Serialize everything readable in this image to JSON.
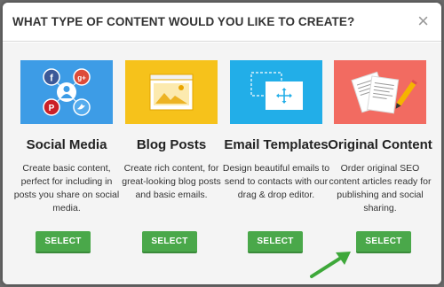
{
  "modal": {
    "title": "WHAT TYPE OF CONTENT WOULD YOU LIKE TO CREATE?",
    "close_glyph": "×"
  },
  "cards": [
    {
      "title": "Social Media",
      "description": "Create basic content, perfect for including in posts you share on social media.",
      "button": "SELECT",
      "image_bg": "#3d9ce6",
      "icon": "social-network-icon"
    },
    {
      "title": "Blog Posts",
      "description": "Create rich content, for great-looking blog posts and basic emails.",
      "button": "SELECT",
      "image_bg": "#f6c21b",
      "icon": "browser-window-icon"
    },
    {
      "title": "Email Templates",
      "description": "Design beautiful emails to send to contacts with our drag & drop editor.",
      "button": "SELECT",
      "image_bg": "#22aee8",
      "icon": "drag-drop-icon"
    },
    {
      "title": "Original Content",
      "description": "Order original SEO content articles ready for publishing and social sharing.",
      "button": "SELECT",
      "image_bg": "#f26b61",
      "icon": "documents-pen-icon"
    }
  ],
  "colors": {
    "select_button": "#4aa84a",
    "arrow": "#3ea83a",
    "overlay": "#6b6b6b"
  }
}
